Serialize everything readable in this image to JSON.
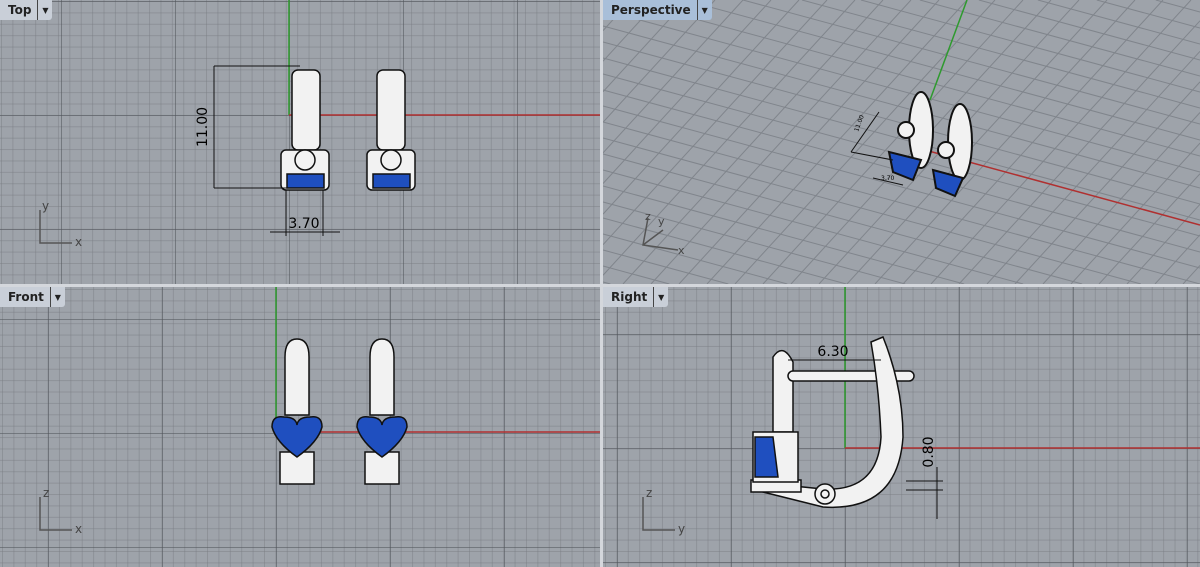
{
  "viewports": {
    "top": {
      "label": "Top",
      "dim_vertical": "11.00",
      "dim_horizontal": "3.70",
      "axis_a": "y",
      "axis_b": "x"
    },
    "perspective": {
      "label": "Perspective",
      "dim_a": "11.00",
      "dim_b": "3.70",
      "axis_a": "z",
      "axis_b": "y",
      "axis_c": "x"
    },
    "front": {
      "label": "Front",
      "axis_a": "z",
      "axis_b": "x"
    },
    "right": {
      "label": "Right",
      "dim_horizontal": "6.30",
      "dim_vertical": "0.80",
      "axis_a": "z",
      "axis_b": "y"
    }
  },
  "colors": {
    "x_axis": "#b03030",
    "y_axis": "#2e9a2e",
    "gem": "#1f4fbf",
    "grid": "#9ea3aa"
  }
}
